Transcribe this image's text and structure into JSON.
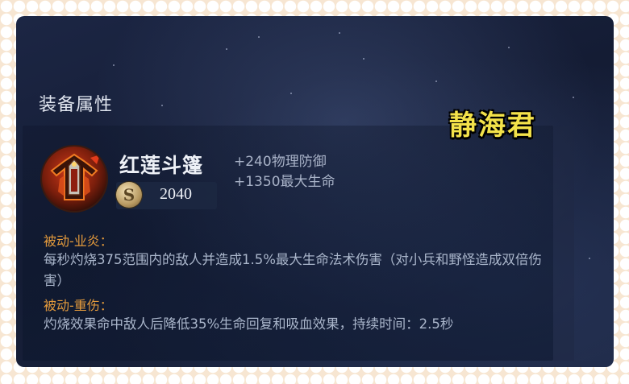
{
  "section_title": "装备属性",
  "watermark": "静海君",
  "item": {
    "name": "红莲斗篷",
    "price": "2040",
    "stats": [
      "+240物理防御",
      "+1350最大生命"
    ]
  },
  "passives": [
    {
      "title": "被动-业炎：",
      "description": "每秒灼烧375范围内的敌人并造成1.5%最大生命法术伤害（对小兵和野怪造成双倍伤害）"
    },
    {
      "title": "被动-重伤：",
      "description": "灼烧效果命中敌人后降低35%生命回复和吸血效果，持续时间：2.5秒"
    }
  ],
  "icons": {
    "item_icon": "red-lotus-cloak-icon",
    "coin_icon": "gold-coin-icon"
  },
  "colors": {
    "passive_title": "#e39a3c",
    "watermark": "#f3e24a"
  }
}
